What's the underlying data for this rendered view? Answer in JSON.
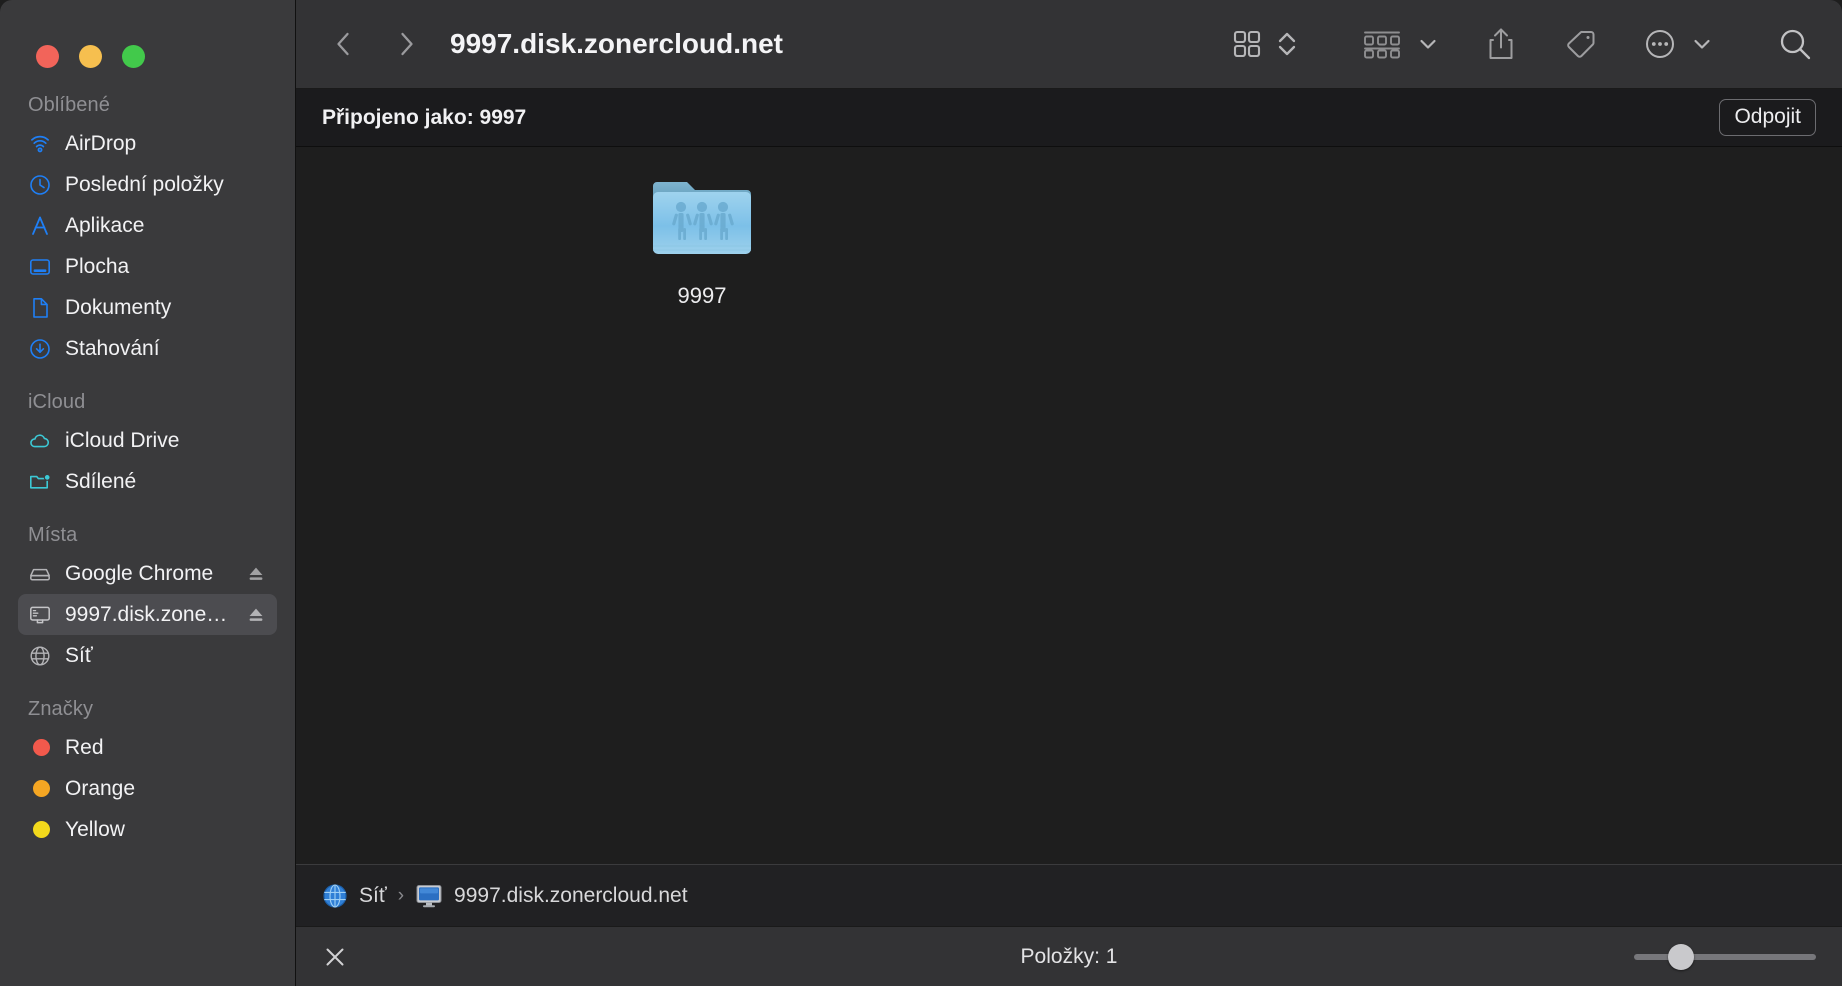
{
  "window": {
    "title": "9997.disk.zonercloud.net",
    "traffic_lights": [
      {
        "name": "close",
        "color": "#f2645a"
      },
      {
        "name": "minimize",
        "color": "#f6bf4f"
      },
      {
        "name": "zoom",
        "color": "#42c94b"
      }
    ]
  },
  "toolbar": {
    "back_label": "Zpět",
    "forward_label": "Vpřed",
    "view_icon": "grid-view-icon",
    "view_chevron_icon": "chevron-updown-icon",
    "group_icon": "group-by-icon",
    "group_chevron_icon": "chevron-down-icon",
    "share_icon": "share-icon",
    "tag_icon": "tag-icon",
    "more_icon": "more-circle-icon",
    "more_chevron_icon": "chevron-down-icon",
    "search_icon": "search-icon"
  },
  "connection": {
    "status_text": "Připojeno jako: 9997",
    "disconnect_label": "Odpojit"
  },
  "sidebar": {
    "sections": [
      {
        "title": "Oblíbené",
        "items": [
          {
            "label": "AirDrop",
            "icon": "airdrop-icon",
            "eject": false,
            "selected": false
          },
          {
            "label": "Poslední položky",
            "icon": "clock-icon",
            "eject": false,
            "selected": false
          },
          {
            "label": "Aplikace",
            "icon": "applications-icon",
            "eject": false,
            "selected": false
          },
          {
            "label": "Plocha",
            "icon": "desktop-icon",
            "eject": false,
            "selected": false
          },
          {
            "label": "Dokumenty",
            "icon": "document-icon",
            "eject": false,
            "selected": false
          },
          {
            "label": "Stahování",
            "icon": "downloads-icon",
            "eject": false,
            "selected": false
          }
        ]
      },
      {
        "title": "iCloud",
        "items": [
          {
            "label": "iCloud Drive",
            "icon": "cloud-icon",
            "eject": false,
            "selected": false
          },
          {
            "label": "Sdílené",
            "icon": "shared-folder-icon",
            "eject": false,
            "selected": false
          }
        ]
      },
      {
        "title": "Místa",
        "items": [
          {
            "label": "Google Chrome",
            "icon": "disk-icon",
            "eject": true,
            "selected": false
          },
          {
            "label": "9997.disk.zonerc...",
            "icon": "server-icon",
            "eject": true,
            "selected": true
          },
          {
            "label": "Síť",
            "icon": "network-globe-icon",
            "eject": false,
            "selected": false
          }
        ]
      },
      {
        "title": "Značky",
        "items": [
          {
            "label": "Red",
            "icon": "tag-dot-icon",
            "color": "#f2594c",
            "eject": false,
            "selected": false
          },
          {
            "label": "Orange",
            "icon": "tag-dot-icon",
            "color": "#f5a623",
            "eject": false,
            "selected": false
          },
          {
            "label": "Yellow",
            "icon": "tag-dot-icon",
            "color": "#f2d91c",
            "eject": false,
            "selected": false
          }
        ]
      }
    ]
  },
  "files": [
    {
      "name": "9997",
      "icon": "shared-folder-icon",
      "kind": "folder"
    }
  ],
  "path_bar": {
    "crumbs": [
      {
        "label": "Síť",
        "icon": "network-globe-icon"
      },
      {
        "label": "9997.disk.zonercloud.net",
        "icon": "server-monitor-icon"
      }
    ],
    "separator": "›"
  },
  "status_bar": {
    "close_icon": "close-x-icon",
    "item_count": "Položky: 1",
    "zoom_slider_value": 22
  },
  "colors": {
    "sidebar_bg": "#3a3a3c",
    "toolbar_bg": "#333335",
    "content_bg": "#1e1e1e",
    "accent_blue": "#1f7ff5",
    "teal": "#3cc9d6",
    "folder_blue": "#7cc0e8"
  }
}
